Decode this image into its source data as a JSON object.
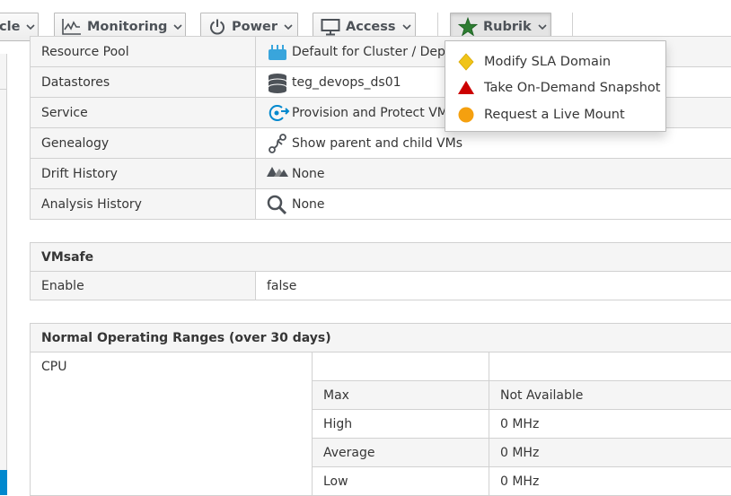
{
  "toolbar": {
    "lifecycle_label": "cle",
    "monitoring_label": "Monitoring",
    "power_label": "Power",
    "access_label": "Access",
    "rubrik_label": "Rubrik"
  },
  "rubrik_menu": {
    "items": [
      {
        "label": "Modify SLA Domain",
        "icon": "yellow-diamond-icon",
        "color": "#f0c419"
      },
      {
        "label": "Take On-Demand Snapshot",
        "icon": "red-triangle-icon",
        "color": "#cc0000"
      },
      {
        "label": "Request a Live Mount",
        "icon": "orange-circle-icon",
        "color": "#f5a00f"
      }
    ]
  },
  "properties": {
    "rows": [
      {
        "label": "Resource Pool",
        "value": "Default for Cluster / Dep",
        "icon": "resource-pool-icon"
      },
      {
        "label": "Datastores",
        "value": "teg_devops_ds01",
        "icon": "datastore-icon"
      },
      {
        "label": "Service",
        "value": "Provision and Protect VM",
        "icon": "service-icon"
      },
      {
        "label": "Genealogy",
        "value": "Show parent and child VMs",
        "icon": "genealogy-icon"
      },
      {
        "label": "Drift History",
        "value": "None",
        "icon": "drift-icon"
      },
      {
        "label": "Analysis History",
        "value": "None",
        "icon": "magnifier-icon"
      }
    ]
  },
  "vmsafe": {
    "title": "VMsafe",
    "rows": [
      {
        "label": "Enable",
        "value": "false"
      }
    ]
  },
  "operating_ranges": {
    "title": "Normal Operating Ranges (over 30 days)",
    "cpu_label": "CPU",
    "rows": [
      {
        "label": "Max",
        "value": "Not Available"
      },
      {
        "label": "High",
        "value": "0 MHz"
      },
      {
        "label": "Average",
        "value": "0 MHz"
      },
      {
        "label": "Low",
        "value": "0 MHz"
      }
    ]
  },
  "colors": {
    "accent": "#0088ce",
    "rubrik_star": "#2e7d32"
  }
}
